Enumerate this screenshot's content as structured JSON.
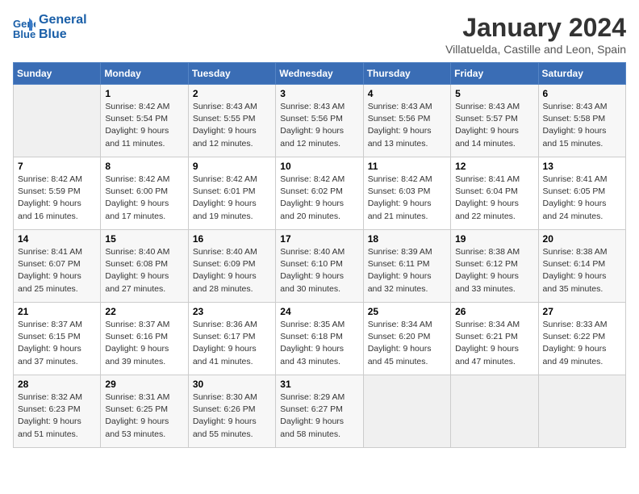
{
  "header": {
    "logo_line1": "General",
    "logo_line2": "Blue",
    "month": "January 2024",
    "location": "Villatuelda, Castille and Leon, Spain"
  },
  "weekdays": [
    "Sunday",
    "Monday",
    "Tuesday",
    "Wednesday",
    "Thursday",
    "Friday",
    "Saturday"
  ],
  "weeks": [
    [
      {
        "day": "",
        "info": ""
      },
      {
        "day": "1",
        "info": "Sunrise: 8:42 AM\nSunset: 5:54 PM\nDaylight: 9 hours\nand 11 minutes."
      },
      {
        "day": "2",
        "info": "Sunrise: 8:43 AM\nSunset: 5:55 PM\nDaylight: 9 hours\nand 12 minutes."
      },
      {
        "day": "3",
        "info": "Sunrise: 8:43 AM\nSunset: 5:56 PM\nDaylight: 9 hours\nand 12 minutes."
      },
      {
        "day": "4",
        "info": "Sunrise: 8:43 AM\nSunset: 5:56 PM\nDaylight: 9 hours\nand 13 minutes."
      },
      {
        "day": "5",
        "info": "Sunrise: 8:43 AM\nSunset: 5:57 PM\nDaylight: 9 hours\nand 14 minutes."
      },
      {
        "day": "6",
        "info": "Sunrise: 8:43 AM\nSunset: 5:58 PM\nDaylight: 9 hours\nand 15 minutes."
      }
    ],
    [
      {
        "day": "7",
        "info": "Sunrise: 8:42 AM\nSunset: 5:59 PM\nDaylight: 9 hours\nand 16 minutes."
      },
      {
        "day": "8",
        "info": "Sunrise: 8:42 AM\nSunset: 6:00 PM\nDaylight: 9 hours\nand 17 minutes."
      },
      {
        "day": "9",
        "info": "Sunrise: 8:42 AM\nSunset: 6:01 PM\nDaylight: 9 hours\nand 19 minutes."
      },
      {
        "day": "10",
        "info": "Sunrise: 8:42 AM\nSunset: 6:02 PM\nDaylight: 9 hours\nand 20 minutes."
      },
      {
        "day": "11",
        "info": "Sunrise: 8:42 AM\nSunset: 6:03 PM\nDaylight: 9 hours\nand 21 minutes."
      },
      {
        "day": "12",
        "info": "Sunrise: 8:41 AM\nSunset: 6:04 PM\nDaylight: 9 hours\nand 22 minutes."
      },
      {
        "day": "13",
        "info": "Sunrise: 8:41 AM\nSunset: 6:05 PM\nDaylight: 9 hours\nand 24 minutes."
      }
    ],
    [
      {
        "day": "14",
        "info": "Sunrise: 8:41 AM\nSunset: 6:07 PM\nDaylight: 9 hours\nand 25 minutes."
      },
      {
        "day": "15",
        "info": "Sunrise: 8:40 AM\nSunset: 6:08 PM\nDaylight: 9 hours\nand 27 minutes."
      },
      {
        "day": "16",
        "info": "Sunrise: 8:40 AM\nSunset: 6:09 PM\nDaylight: 9 hours\nand 28 minutes."
      },
      {
        "day": "17",
        "info": "Sunrise: 8:40 AM\nSunset: 6:10 PM\nDaylight: 9 hours\nand 30 minutes."
      },
      {
        "day": "18",
        "info": "Sunrise: 8:39 AM\nSunset: 6:11 PM\nDaylight: 9 hours\nand 32 minutes."
      },
      {
        "day": "19",
        "info": "Sunrise: 8:38 AM\nSunset: 6:12 PM\nDaylight: 9 hours\nand 33 minutes."
      },
      {
        "day": "20",
        "info": "Sunrise: 8:38 AM\nSunset: 6:14 PM\nDaylight: 9 hours\nand 35 minutes."
      }
    ],
    [
      {
        "day": "21",
        "info": "Sunrise: 8:37 AM\nSunset: 6:15 PM\nDaylight: 9 hours\nand 37 minutes."
      },
      {
        "day": "22",
        "info": "Sunrise: 8:37 AM\nSunset: 6:16 PM\nDaylight: 9 hours\nand 39 minutes."
      },
      {
        "day": "23",
        "info": "Sunrise: 8:36 AM\nSunset: 6:17 PM\nDaylight: 9 hours\nand 41 minutes."
      },
      {
        "day": "24",
        "info": "Sunrise: 8:35 AM\nSunset: 6:18 PM\nDaylight: 9 hours\nand 43 minutes."
      },
      {
        "day": "25",
        "info": "Sunrise: 8:34 AM\nSunset: 6:20 PM\nDaylight: 9 hours\nand 45 minutes."
      },
      {
        "day": "26",
        "info": "Sunrise: 8:34 AM\nSunset: 6:21 PM\nDaylight: 9 hours\nand 47 minutes."
      },
      {
        "day": "27",
        "info": "Sunrise: 8:33 AM\nSunset: 6:22 PM\nDaylight: 9 hours\nand 49 minutes."
      }
    ],
    [
      {
        "day": "28",
        "info": "Sunrise: 8:32 AM\nSunset: 6:23 PM\nDaylight: 9 hours\nand 51 minutes."
      },
      {
        "day": "29",
        "info": "Sunrise: 8:31 AM\nSunset: 6:25 PM\nDaylight: 9 hours\nand 53 minutes."
      },
      {
        "day": "30",
        "info": "Sunrise: 8:30 AM\nSunset: 6:26 PM\nDaylight: 9 hours\nand 55 minutes."
      },
      {
        "day": "31",
        "info": "Sunrise: 8:29 AM\nSunset: 6:27 PM\nDaylight: 9 hours\nand 58 minutes."
      },
      {
        "day": "",
        "info": ""
      },
      {
        "day": "",
        "info": ""
      },
      {
        "day": "",
        "info": ""
      }
    ]
  ]
}
